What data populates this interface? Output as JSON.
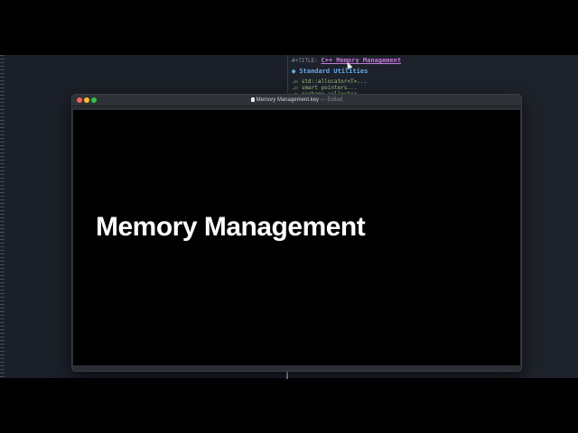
{
  "editor": {
    "title_prefix": "#+TITLE:",
    "title": "C++ Memory Management",
    "heading": "● Standard Utilities",
    "items": [
      ".▷ std::allocator<T>...",
      ".▷ smart pointers...",
      ".▷ garbage collector"
    ]
  },
  "window": {
    "title": "Memory Management.key",
    "status": "— Edited"
  },
  "slide": {
    "title": "Memory Management"
  }
}
